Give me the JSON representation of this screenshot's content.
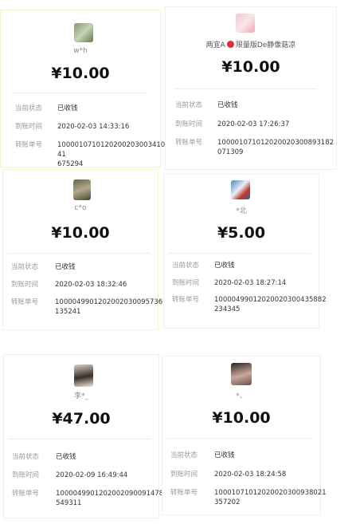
{
  "labels": {
    "status": "当前状态",
    "arrival_time": "到账时间",
    "transfer_no": "转账单号"
  },
  "cards": [
    {
      "nickname": "w*h",
      "amount": "¥10.00",
      "status": "已收钱",
      "time": "2020-02-03 14:33:16",
      "transfer_no_line1": "1000010710120200203003410​41",
      "transfer_no_line2": "675294"
    },
    {
      "nickname_pre": "两宜A",
      "nickname_post": "限量版De静像菇凉",
      "amount": "¥10.00",
      "status": "已收钱",
      "time": "2020-02-03 17:26:37",
      "transfer_no_line1": "10000107101202002030089318​2",
      "transfer_no_line2": "071309"
    },
    {
      "nickname": "c*o",
      "amount": "¥10.00",
      "status": "已收钱",
      "time": "2020-02-03 18:32:46",
      "transfer_no_line1": "10000499012020020300957366",
      "transfer_no_line2": "135241"
    },
    {
      "nickname": "*北",
      "amount": "¥5.00",
      "status": "已收钱",
      "time": "2020-02-03 18:27:14",
      "transfer_no_line1": "10000499012020020300435882",
      "transfer_no_line2": "234345"
    },
    {
      "nickname": "李*_",
      "amount": "¥47.00",
      "status": "已收钱",
      "time": "2020-02-09 16:49:44",
      "transfer_no_line1": "10000499012020020900914788",
      "transfer_no_line2": "549311"
    },
    {
      "nickname": "*、",
      "amount": "¥10.00",
      "status": "已收钱",
      "time": "2020-02-03 18:24:58",
      "transfer_no_line1": "10001071012020020300938021",
      "transfer_no_line2": "357202"
    }
  ]
}
